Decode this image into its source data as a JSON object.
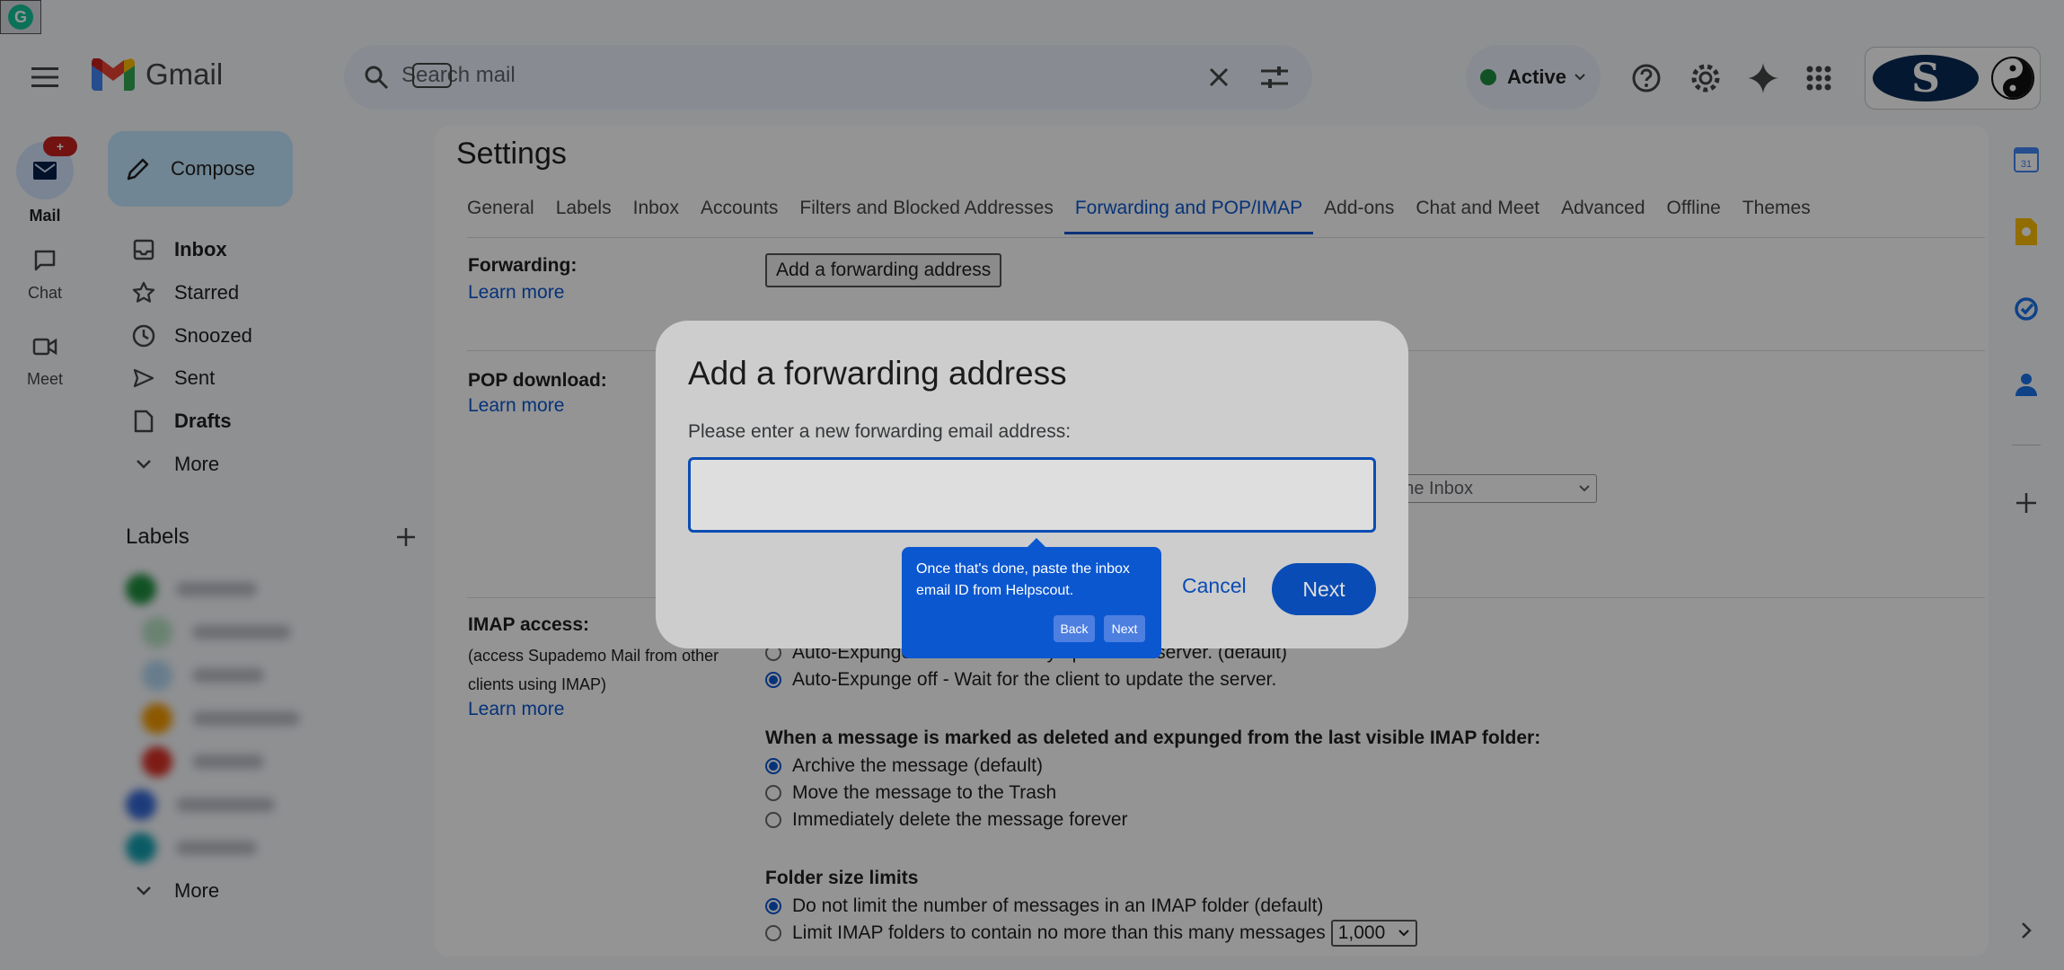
{
  "app": {
    "name": "Gmail"
  },
  "search": {
    "placeholder": "Search mail"
  },
  "status": {
    "label": "Active",
    "color": "#1e8e3e"
  },
  "account": {
    "logo_letter": "S"
  },
  "rail": [
    {
      "label": "Mail",
      "badge": "+"
    },
    {
      "label": "Chat"
    },
    {
      "label": "Meet"
    }
  ],
  "sidebar": {
    "compose": "Compose",
    "items": [
      {
        "label": "Inbox",
        "icon": "inbox-icon",
        "bold": true
      },
      {
        "label": "Starred",
        "icon": "star-icon"
      },
      {
        "label": "Snoozed",
        "icon": "clock-icon"
      },
      {
        "label": "Sent",
        "icon": "send-icon"
      },
      {
        "label": "Drafts",
        "icon": "file-icon",
        "bold": true
      },
      {
        "label": "More",
        "icon": "chevron-down-icon"
      }
    ],
    "labels_title": "Labels",
    "labels_more": "More",
    "label_colors": [
      "#1e8e3e",
      "#b7e1c4",
      "#b3d7f2",
      "#f29900",
      "#d93025",
      "#3367d6",
      "#129eaf"
    ]
  },
  "settings": {
    "title": "Settings",
    "tabs": [
      "General",
      "Labels",
      "Inbox",
      "Accounts",
      "Filters and Blocked Addresses",
      "Forwarding and POP/IMAP",
      "Add-ons",
      "Chat and Meet",
      "Advanced",
      "Offline",
      "Themes"
    ],
    "active_tab": "Forwarding and POP/IMAP",
    "forwarding": {
      "head": "Forwarding:",
      "learn": "Learn more",
      "button": "Add a forwarding address"
    },
    "pop": {
      "head": "POP download:",
      "learn": "Learn more",
      "select_fragment": "n the Inbox"
    },
    "imap": {
      "head": "IMAP access:",
      "desc": "(access Supademo Mail from other clients using IMAP)",
      "learn": "Learn more",
      "expunge_on": "Auto-Expunge on - Immediately update the server. (default)",
      "expunge_off": "Auto-Expunge off - Wait for the client to update the server.",
      "deleted_head": "When a message is marked as deleted and expunged from the last visible IMAP folder:",
      "deleted_opts": [
        "Archive the message (default)",
        "Move the message to the Trash",
        "Immediately delete the message forever"
      ],
      "folder_head": "Folder size limits",
      "folder_opts": [
        "Do not limit the number of messages in an IMAP folder (default)",
        "Limit IMAP folders to contain no more than this many messages"
      ],
      "folder_limit": "1,000"
    }
  },
  "dialog": {
    "title": "Add a forwarding address",
    "prompt": "Please enter a new forwarding email address:",
    "input_value": "",
    "cancel": "Cancel",
    "next": "Next"
  },
  "tooltip": {
    "text": "Once that's done, paste the inbox email ID from Helpscout.",
    "back": "Back",
    "next": "Next"
  }
}
